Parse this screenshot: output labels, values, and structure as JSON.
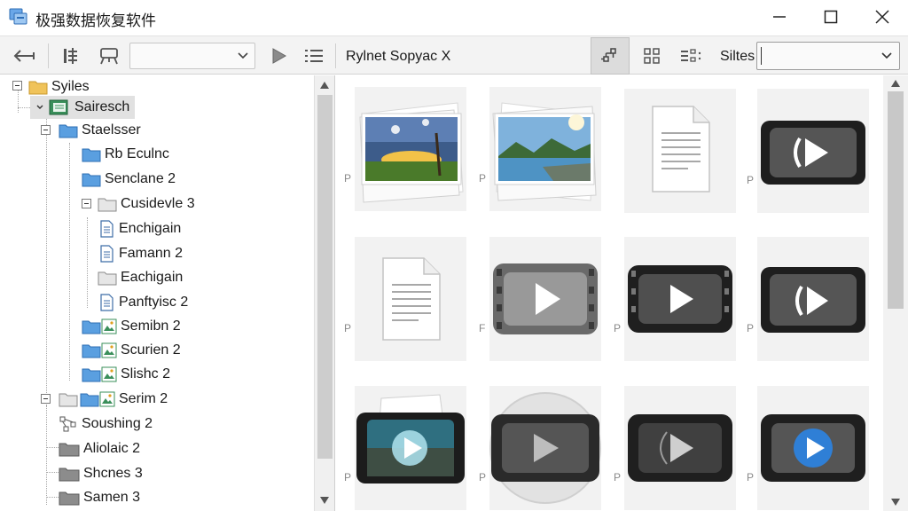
{
  "window": {
    "title": "极强数据恢复软件",
    "icon": "app-drive-icon",
    "controls": [
      "minimize-icon",
      "maximize-icon",
      "close-icon"
    ]
  },
  "toolbar": {
    "back_icon": "back-arrow-icon",
    "tools": [
      "filter-icon",
      "scan-icon"
    ],
    "combo_value": "",
    "play_icon": "play-icon",
    "list_icon": "list-icon",
    "path_label": "Rylnet Sopyac X",
    "view_icons": [
      "tree-view-icon",
      "grid-view-icon",
      "detail-view-icon"
    ],
    "sort_label": "Siltes",
    "sort_value": ""
  },
  "tree": {
    "items": [
      {
        "label": "Syiles",
        "icon": "folder-yellow"
      },
      {
        "label": "Sairesch",
        "icon": "drive-green",
        "selected": true
      },
      {
        "label": "Staelsser",
        "icon": "folder-blue"
      },
      {
        "label": "Rb Eculnc",
        "icon": "folder-blue"
      },
      {
        "label": "Senclane 2",
        "icon": "folder-blue"
      },
      {
        "label": "Cusidevle 3",
        "icon": "folder-gray"
      },
      {
        "label": "Enchigain",
        "icon": "file-doc"
      },
      {
        "label": "Famann 2",
        "icon": "file-doc"
      },
      {
        "label": "Eachigain",
        "icon": "folder-gray"
      },
      {
        "label": "Panftyisc 2",
        "icon": "file-doc"
      },
      {
        "label": "Semibn 2",
        "icon": "image-file"
      },
      {
        "label": "Scurien 2",
        "icon": "image-file"
      },
      {
        "label": "Slishc 2",
        "icon": "image-file"
      },
      {
        "label": "Serim 2",
        "icon": "image-file"
      },
      {
        "label": "Soushing 2",
        "icon": "network"
      },
      {
        "label": "Aliolaic 2",
        "icon": "folder-dark"
      },
      {
        "label": "Shcnes 3",
        "icon": "folder-dark"
      },
      {
        "label": "Samen 3",
        "icon": "folder-dark"
      }
    ]
  },
  "grid": {
    "tiles": [
      {
        "type": "photo-sunset",
        "tag": "P"
      },
      {
        "type": "photo-lake",
        "tag": "P"
      },
      {
        "type": "document",
        "tag": "P"
      },
      {
        "type": "video-dark",
        "tag": "P"
      },
      {
        "type": "document",
        "tag": "P"
      },
      {
        "type": "video-gray",
        "tag": "F"
      },
      {
        "type": "video-dark",
        "tag": "P"
      },
      {
        "type": "video-dark",
        "tag": "P"
      },
      {
        "type": "video-teal",
        "tag": "P"
      },
      {
        "type": "video-gray-circle",
        "tag": "P"
      },
      {
        "type": "video-dark",
        "tag": "P"
      },
      {
        "type": "video-blue",
        "tag": "P"
      }
    ]
  },
  "colors": {
    "selection": "#e1e1e1",
    "folder_yellow": "#f0c35a",
    "folder_blue": "#5a9fe0",
    "toolbar_bg": "#f3f3f3"
  }
}
